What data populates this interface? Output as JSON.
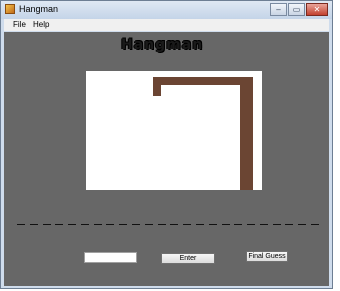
{
  "window": {
    "title": "Hangman",
    "controls": {
      "minimize": "–",
      "maximize": "▭",
      "close": "✕"
    }
  },
  "menu": {
    "items": [
      "File",
      "Help"
    ]
  },
  "game": {
    "heading": "Hangman",
    "gallows_color": "#6b4533",
    "canvas_color": "#ffffff",
    "blank_count": 24
  },
  "controls": {
    "guess_value": "",
    "enter_label": "Enter",
    "final_guess_label": "Final Guess"
  },
  "colors": {
    "client_background": "#676767",
    "frame": "#cfdcec"
  }
}
